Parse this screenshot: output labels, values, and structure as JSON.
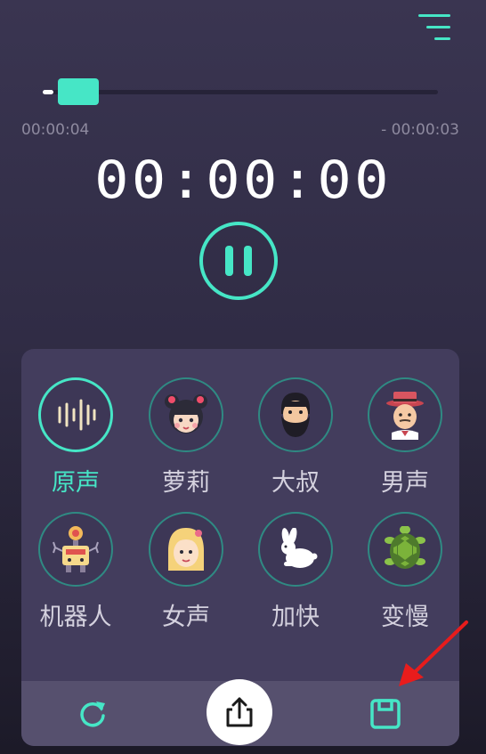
{
  "player": {
    "elapsed": "00:00:04",
    "remaining": "- 00:00:03",
    "timer": "00:00:00",
    "progress": 0.1
  },
  "effects": [
    {
      "label": "原声",
      "icon": "waveform-icon",
      "active": true
    },
    {
      "label": "萝莉",
      "icon": "girl-face-icon",
      "active": false
    },
    {
      "label": "大叔",
      "icon": "bearded-man-icon",
      "active": false
    },
    {
      "label": "男声",
      "icon": "man-hat-icon",
      "active": false
    },
    {
      "label": "机器人",
      "icon": "robot-icon",
      "active": false
    },
    {
      "label": "女声",
      "icon": "woman-face-icon",
      "active": false
    },
    {
      "label": "加快",
      "icon": "rabbit-icon",
      "active": false
    },
    {
      "label": "变慢",
      "icon": "turtle-icon",
      "active": false
    }
  ],
  "toolbar": {
    "left_icon": "refresh-icon",
    "center_icon": "share-icon",
    "right_icon": "save-icon"
  },
  "colors": {
    "accent": "#46e6c6",
    "annotation_arrow": "#e81c1c",
    "panel": "#433d5d"
  }
}
